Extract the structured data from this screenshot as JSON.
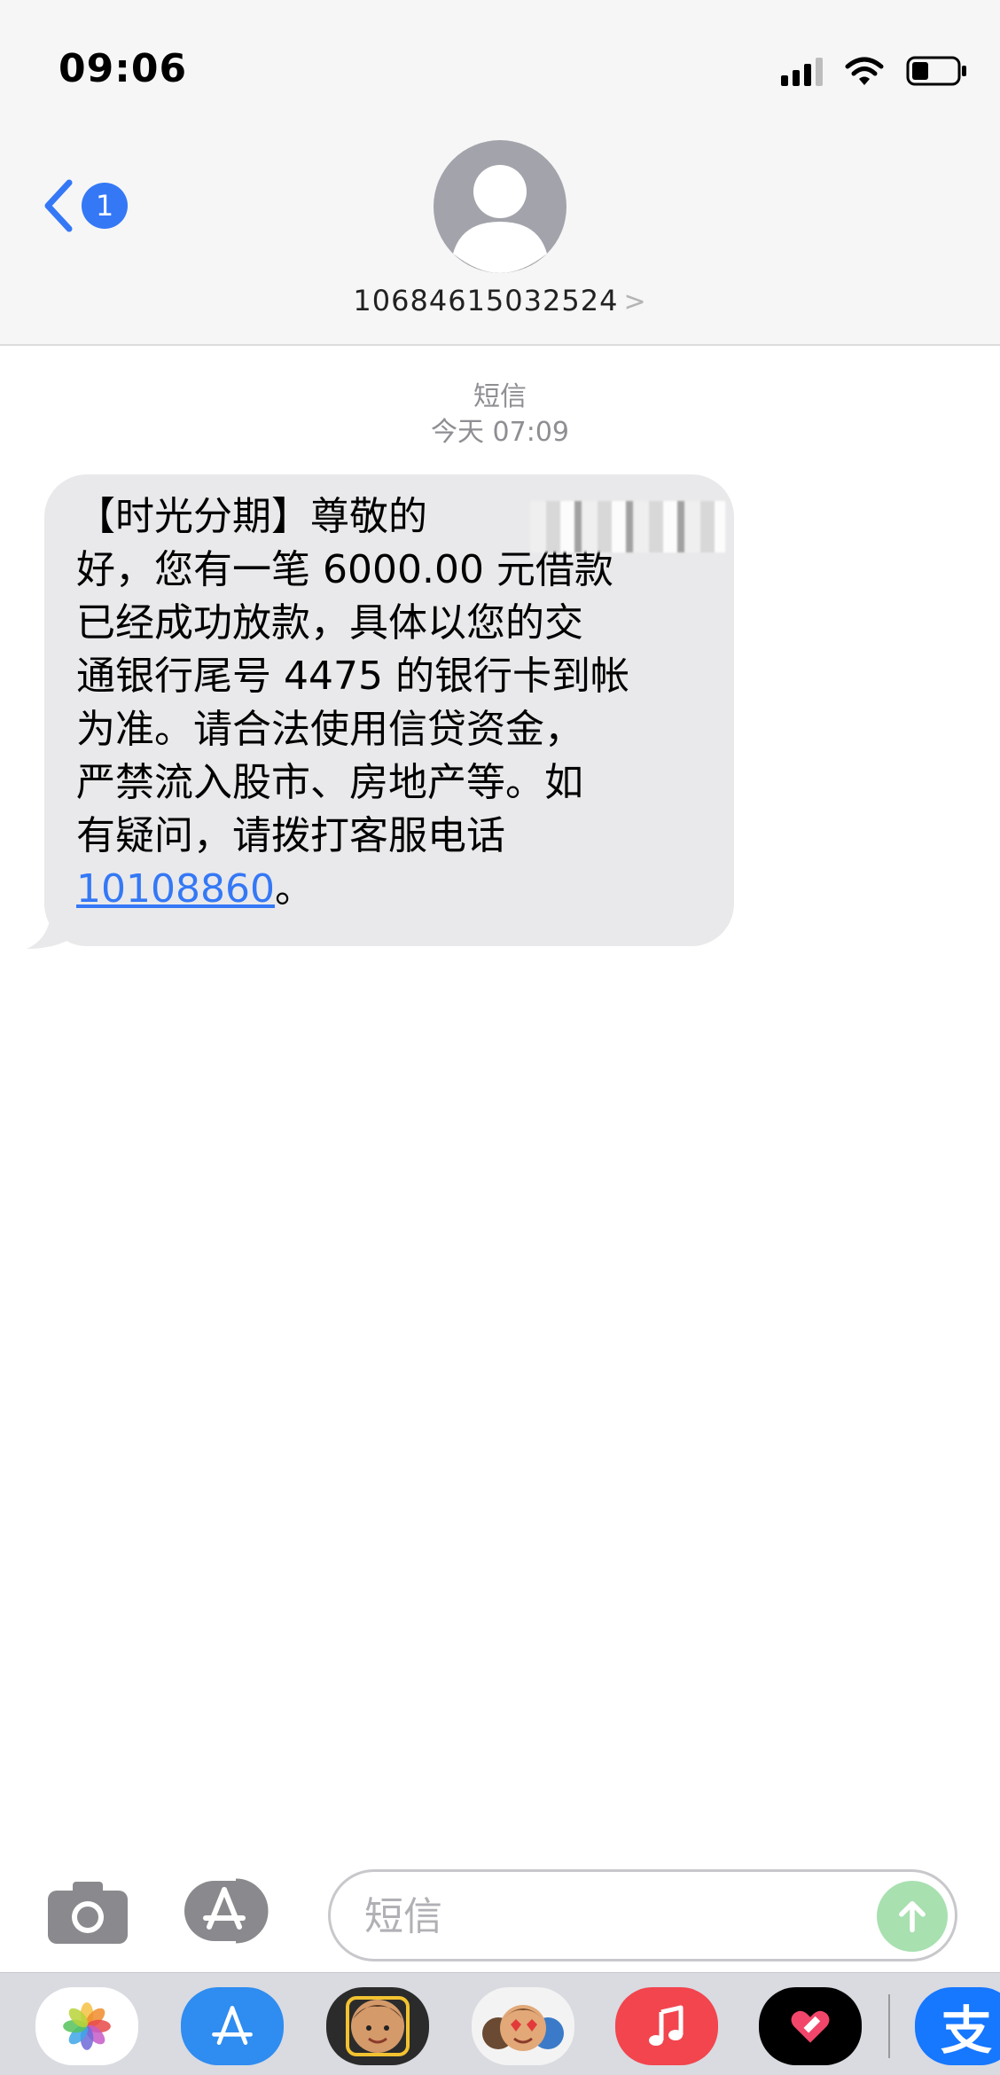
{
  "status_bar": {
    "time": "09:06"
  },
  "nav": {
    "back_badge": "1",
    "contact": "10684615032524",
    "contact_chevron": ">"
  },
  "thread": {
    "service": "短信",
    "timestamp": "今天 07:09"
  },
  "message": {
    "text": "【时光分期】尊敬的\n好，您有一笔 6000.00 元借款\n已经成功放款，具体以您的交\n通银行尾号 4475 的银行卡到帐\n为准。请合法使用信贷资金，\n严禁流入股市、房地产等。如\n有疑问，请拨打客服电话\n",
    "phone": "10108860",
    "end": "。"
  },
  "composer": {
    "placeholder": "短信"
  },
  "drawer": {
    "apps": [
      "photos-icon",
      "app-store-icon",
      "memoji-icon",
      "animoji-icon",
      "music-icon",
      "digital-touch-icon",
      "alipay-icon"
    ],
    "alipay_glyph": "支"
  },
  "colors": {
    "accent": "#3478f6",
    "bubble": "#e9e9eb",
    "send": "#a8e0b0"
  }
}
